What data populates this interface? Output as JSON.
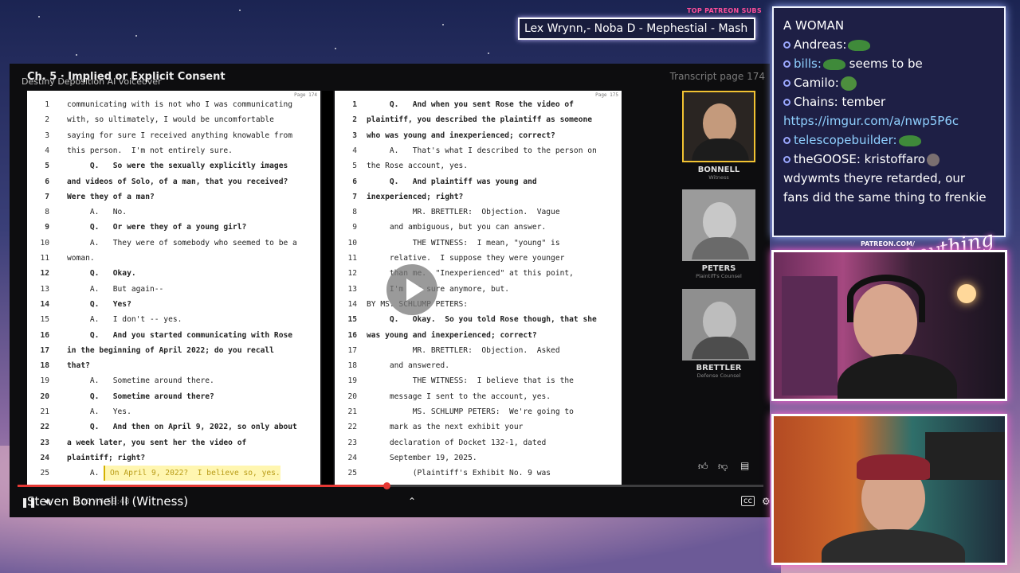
{
  "overlay": {
    "subs_label": "TOP PATREON SUBS",
    "subs_text": "Lex Wrynn,-  Noba D - Mephestial - Mash",
    "patreon_tag": "PATREON.COM/",
    "brand_script": "Anything Else?"
  },
  "player": {
    "chapter": "Ch. 5 · Implied or Explicit Consent",
    "video_title": "Destiny Deposition AI voiceover",
    "transcript_page": "Transcript page 174",
    "now_speaking": "Steven Bonnell II (Witness)",
    "timestamp": "0:00 / 4:59:48",
    "progress": 0.495
  },
  "transcript": {
    "left": {
      "page_label": "Page 174",
      "lines": [
        {
          "n": "1",
          "t": "communicating with is not who I was communicating",
          "b": false
        },
        {
          "n": "2",
          "t": "with, so ultimately, I would be uncomfortable",
          "b": false
        },
        {
          "n": "3",
          "t": "saying for sure I received anything knowable from",
          "b": false
        },
        {
          "n": "4",
          "t": "this person.  I'm not entirely sure.",
          "b": false
        },
        {
          "n": "5",
          "t": "     Q.   So were the sexually explicitly images",
          "b": true
        },
        {
          "n": "6",
          "t": "and videos of Solo, of a man, that you received?",
          "b": true
        },
        {
          "n": "7",
          "t": "Were they of a man?",
          "b": true
        },
        {
          "n": "8",
          "t": "     A.   No.",
          "b": false
        },
        {
          "n": "9",
          "t": "     Q.   Or were they of a young girl?",
          "b": true
        },
        {
          "n": "10",
          "t": "     A.   They were of somebody who seemed to be a",
          "b": false
        },
        {
          "n": "11",
          "t": "woman.",
          "b": false
        },
        {
          "n": "12",
          "t": "     Q.   Okay.",
          "b": true
        },
        {
          "n": "13",
          "t": "     A.   But again--",
          "b": false
        },
        {
          "n": "14",
          "t": "     Q.   Yes?",
          "b": true
        },
        {
          "n": "15",
          "t": "     A.   I don't -- yes.",
          "b": false
        },
        {
          "n": "16",
          "t": "     Q.   And you started communicating with Rose",
          "b": true
        },
        {
          "n": "17",
          "t": "in the beginning of April 2022; do you recall",
          "b": true
        },
        {
          "n": "18",
          "t": "that?",
          "b": true
        },
        {
          "n": "19",
          "t": "     A.   Sometime around there.",
          "b": false
        },
        {
          "n": "20",
          "t": "     Q.   Sometime around there?",
          "b": true
        },
        {
          "n": "21",
          "t": "     A.   Yes.",
          "b": false
        },
        {
          "n": "22",
          "t": "     Q.   And then on April 9, 2022, so only about",
          "b": true
        },
        {
          "n": "23",
          "t": "a week later, you sent her the video of",
          "b": true
        },
        {
          "n": "24",
          "t": "plaintiff; right?",
          "b": true
        },
        {
          "n": "25",
          "t": "     A.",
          "b": false
        }
      ],
      "highlight": "On April 9, 2022?  I believe so, yes."
    },
    "right": {
      "page_label": "Page 175",
      "lines": [
        {
          "n": "1",
          "t": "     Q.   And when you sent Rose the video of",
          "b": true
        },
        {
          "n": "2",
          "t": "plaintiff, you described the plaintiff as someone",
          "b": true
        },
        {
          "n": "3",
          "t": "who was young and inexperienced; correct?",
          "b": true
        },
        {
          "n": "4",
          "t": "     A.   That's what I described to the person on",
          "b": false
        },
        {
          "n": "5",
          "t": "the Rose account, yes.",
          "b": false
        },
        {
          "n": "6",
          "t": "     Q.   And plaintiff was young and",
          "b": true
        },
        {
          "n": "7",
          "t": "inexperienced; right?",
          "b": true
        },
        {
          "n": "8",
          "t": "          MR. BRETTLER:  Objection.  Vague",
          "b": false
        },
        {
          "n": "9",
          "t": "     and ambiguous, but you can answer.",
          "b": false
        },
        {
          "n": "10",
          "t": "          THE WITNESS:  I mean, \"young\" is",
          "b": false
        },
        {
          "n": "11",
          "t": "     relative.  I suppose they were younger",
          "b": false
        },
        {
          "n": "12",
          "t": "     than me.  \"Inexperienced\" at this point,",
          "b": false
        },
        {
          "n": "13",
          "t": "     I'm not sure anymore, but.",
          "b": false
        },
        {
          "n": "14",
          "t": "BY MS. SCHLUMP PETERS:",
          "b": false
        },
        {
          "n": "15",
          "t": "     Q.   Okay.  So you told Rose though, that she",
          "b": true
        },
        {
          "n": "16",
          "t": "was young and inexperienced; correct?",
          "b": true
        },
        {
          "n": "17",
          "t": "          MR. BRETTLER:  Objection.  Asked",
          "b": false
        },
        {
          "n": "18",
          "t": "     and answered.",
          "b": false
        },
        {
          "n": "19",
          "t": "          THE WITNESS:  I believe that is the",
          "b": false
        },
        {
          "n": "20",
          "t": "     message I sent to the account, yes.",
          "b": false
        },
        {
          "n": "21",
          "t": "          MS. SCHLUMP PETERS:  We're going to",
          "b": false
        },
        {
          "n": "22",
          "t": "     mark as the next exhibit your",
          "b": false
        },
        {
          "n": "23",
          "t": "     declaration of Docket 132-1, dated",
          "b": false
        },
        {
          "n": "24",
          "t": "     September 19, 2025.",
          "b": false
        },
        {
          "n": "25",
          "t": "          (Plaintiff's Exhibit No. 9 was",
          "b": false
        }
      ]
    }
  },
  "witnesses": [
    {
      "name": "BONNELL",
      "role": "Witness",
      "active": true
    },
    {
      "name": "PETERS",
      "role": "Plaintiff's Counsel",
      "active": false
    },
    {
      "name": "BRETTLER",
      "role": "Defense Counsel",
      "active": false
    }
  ],
  "chat": {
    "messages": [
      {
        "user": "A WOMAN",
        "text": "",
        "emote": "",
        "dot": false
      },
      {
        "user": "Andreas:",
        "text": "",
        "emote": "frog",
        "dot": true
      },
      {
        "user": "bills:",
        "text": " seems to be",
        "emote": "frog",
        "dot": true
      },
      {
        "user": "Camilo:",
        "text": "",
        "emote": "frog-face",
        "dot": true
      },
      {
        "user": "Chains:",
        "text": " tember",
        "emote": "",
        "dot": true
      },
      {
        "user": "",
        "text": "https://imgur.com/a/nwp5P6c",
        "emote": "",
        "dot": false
      },
      {
        "user": "telescopebuilder:",
        "text": "",
        "emote": "frog",
        "dot": true
      },
      {
        "user": "theGOOSE:",
        "text": " kristoffaro",
        "emote": "gray",
        "dot": true
      },
      {
        "user": "",
        "text": "wdywmts theyre retarded, our",
        "emote": "",
        "dot": false
      },
      {
        "user": "",
        "text": "fans did the same thing to frenkie",
        "emote": "",
        "dot": false
      }
    ]
  },
  "colors": {
    "accent_red": "#e53935",
    "active_border": "#f1c232",
    "chat_link": "#8fd0ff",
    "neon_pink": "#ff5fd0"
  }
}
